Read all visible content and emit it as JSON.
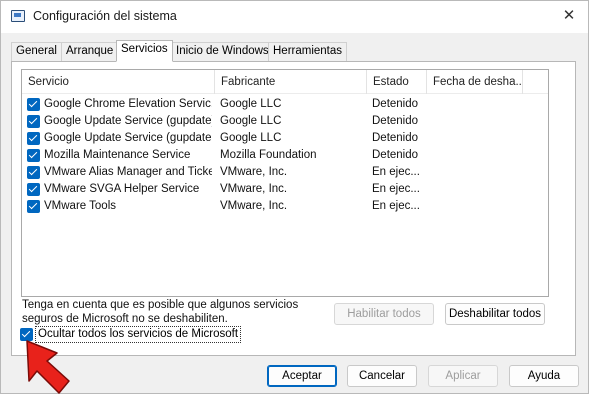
{
  "window": {
    "title": "Configuración del sistema",
    "close_glyph": "✕"
  },
  "tabs": [
    {
      "label": "General",
      "active": false
    },
    {
      "label": "Arranque",
      "active": false
    },
    {
      "label": "Servicios",
      "active": true
    },
    {
      "label": "Inicio de Windows",
      "active": false
    },
    {
      "label": "Herramientas",
      "active": false
    }
  ],
  "services_table": {
    "columns": [
      "Servicio",
      "Fabricante",
      "Estado",
      "Fecha de desha..."
    ],
    "rows": [
      {
        "checked": true,
        "service": "Google Chrome Elevation Servic...",
        "manufacturer": "Google LLC",
        "status": "Detenido",
        "disabled_date": ""
      },
      {
        "checked": true,
        "service": "Google Update Service (gupdate)",
        "manufacturer": "Google LLC",
        "status": "Detenido",
        "disabled_date": ""
      },
      {
        "checked": true,
        "service": "Google Update Service (gupdatem)",
        "manufacturer": "Google LLC",
        "status": "Detenido",
        "disabled_date": ""
      },
      {
        "checked": true,
        "service": "Mozilla Maintenance Service",
        "manufacturer": "Mozilla Foundation",
        "status": "Detenido",
        "disabled_date": ""
      },
      {
        "checked": true,
        "service": "VMware Alias Manager and Ticke...",
        "manufacturer": "VMware, Inc.",
        "status": "En ejec...",
        "disabled_date": ""
      },
      {
        "checked": true,
        "service": "VMware SVGA Helper Service",
        "manufacturer": "VMware, Inc.",
        "status": "En ejec...",
        "disabled_date": ""
      },
      {
        "checked": true,
        "service": "VMware Tools",
        "manufacturer": "VMware, Inc.",
        "status": "En ejec...",
        "disabled_date": ""
      }
    ]
  },
  "note": {
    "line1": "Tenga en cuenta que es posible que algunos servicios",
    "line2": "seguros de Microsoft no se deshabiliten."
  },
  "buttons": {
    "enable_all": "Habilitar todos",
    "disable_all": "Deshabilitar todos",
    "ok": "Aceptar",
    "cancel": "Cancelar",
    "apply": "Aplicar",
    "help": "Ayuda"
  },
  "hide_microsoft": {
    "checked": true,
    "label": "Ocultar todos los servicios de Microsoft"
  },
  "colors": {
    "accent": "#0067c0",
    "arrow_fill": "#e8221b"
  },
  "icons": [
    "app-config-icon",
    "close-icon",
    "checkbox-checked-icon",
    "red-arrow-annotation"
  ]
}
